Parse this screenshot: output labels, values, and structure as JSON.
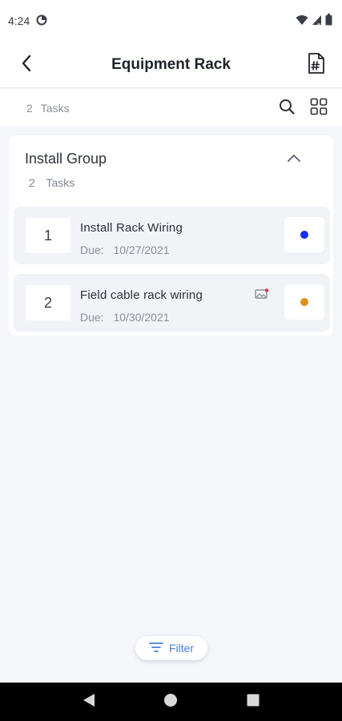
{
  "status_bar": {
    "time": "4:24",
    "left_icon": "data-saver-icon",
    "right_icons": [
      "wifi-icon",
      "signal-icon",
      "battery-icon"
    ]
  },
  "app_bar": {
    "title": "Equipment Rack",
    "back_icon": "back-chevron-icon",
    "action_icon": "document-hash-icon"
  },
  "subheader": {
    "count": "2",
    "label": "Tasks",
    "actions": [
      "search-icon",
      "grid-view-icon"
    ]
  },
  "group": {
    "title": "Install Group",
    "count": "2",
    "count_label": "Tasks",
    "collapse_icon": "chevron-up-icon",
    "tasks": [
      {
        "number": "1",
        "name": "Install Rack Wiring",
        "due_label": "Due:",
        "due_date": "10/27/2021",
        "status_color": "#1430e8",
        "has_attachment": false
      },
      {
        "number": "2",
        "name": "Field cable rack wiring",
        "due_label": "Due:",
        "due_date": "10/30/2021",
        "status_color": "#e0901a",
        "has_attachment": true,
        "attachment_icon": "image-attachment-icon"
      }
    ]
  },
  "filter": {
    "label": "Filter",
    "icon": "filter-lines-icon",
    "color": "#4a7fd8"
  },
  "nav_bar": [
    "nav-back-icon",
    "nav-home-icon",
    "nav-recents-icon"
  ]
}
